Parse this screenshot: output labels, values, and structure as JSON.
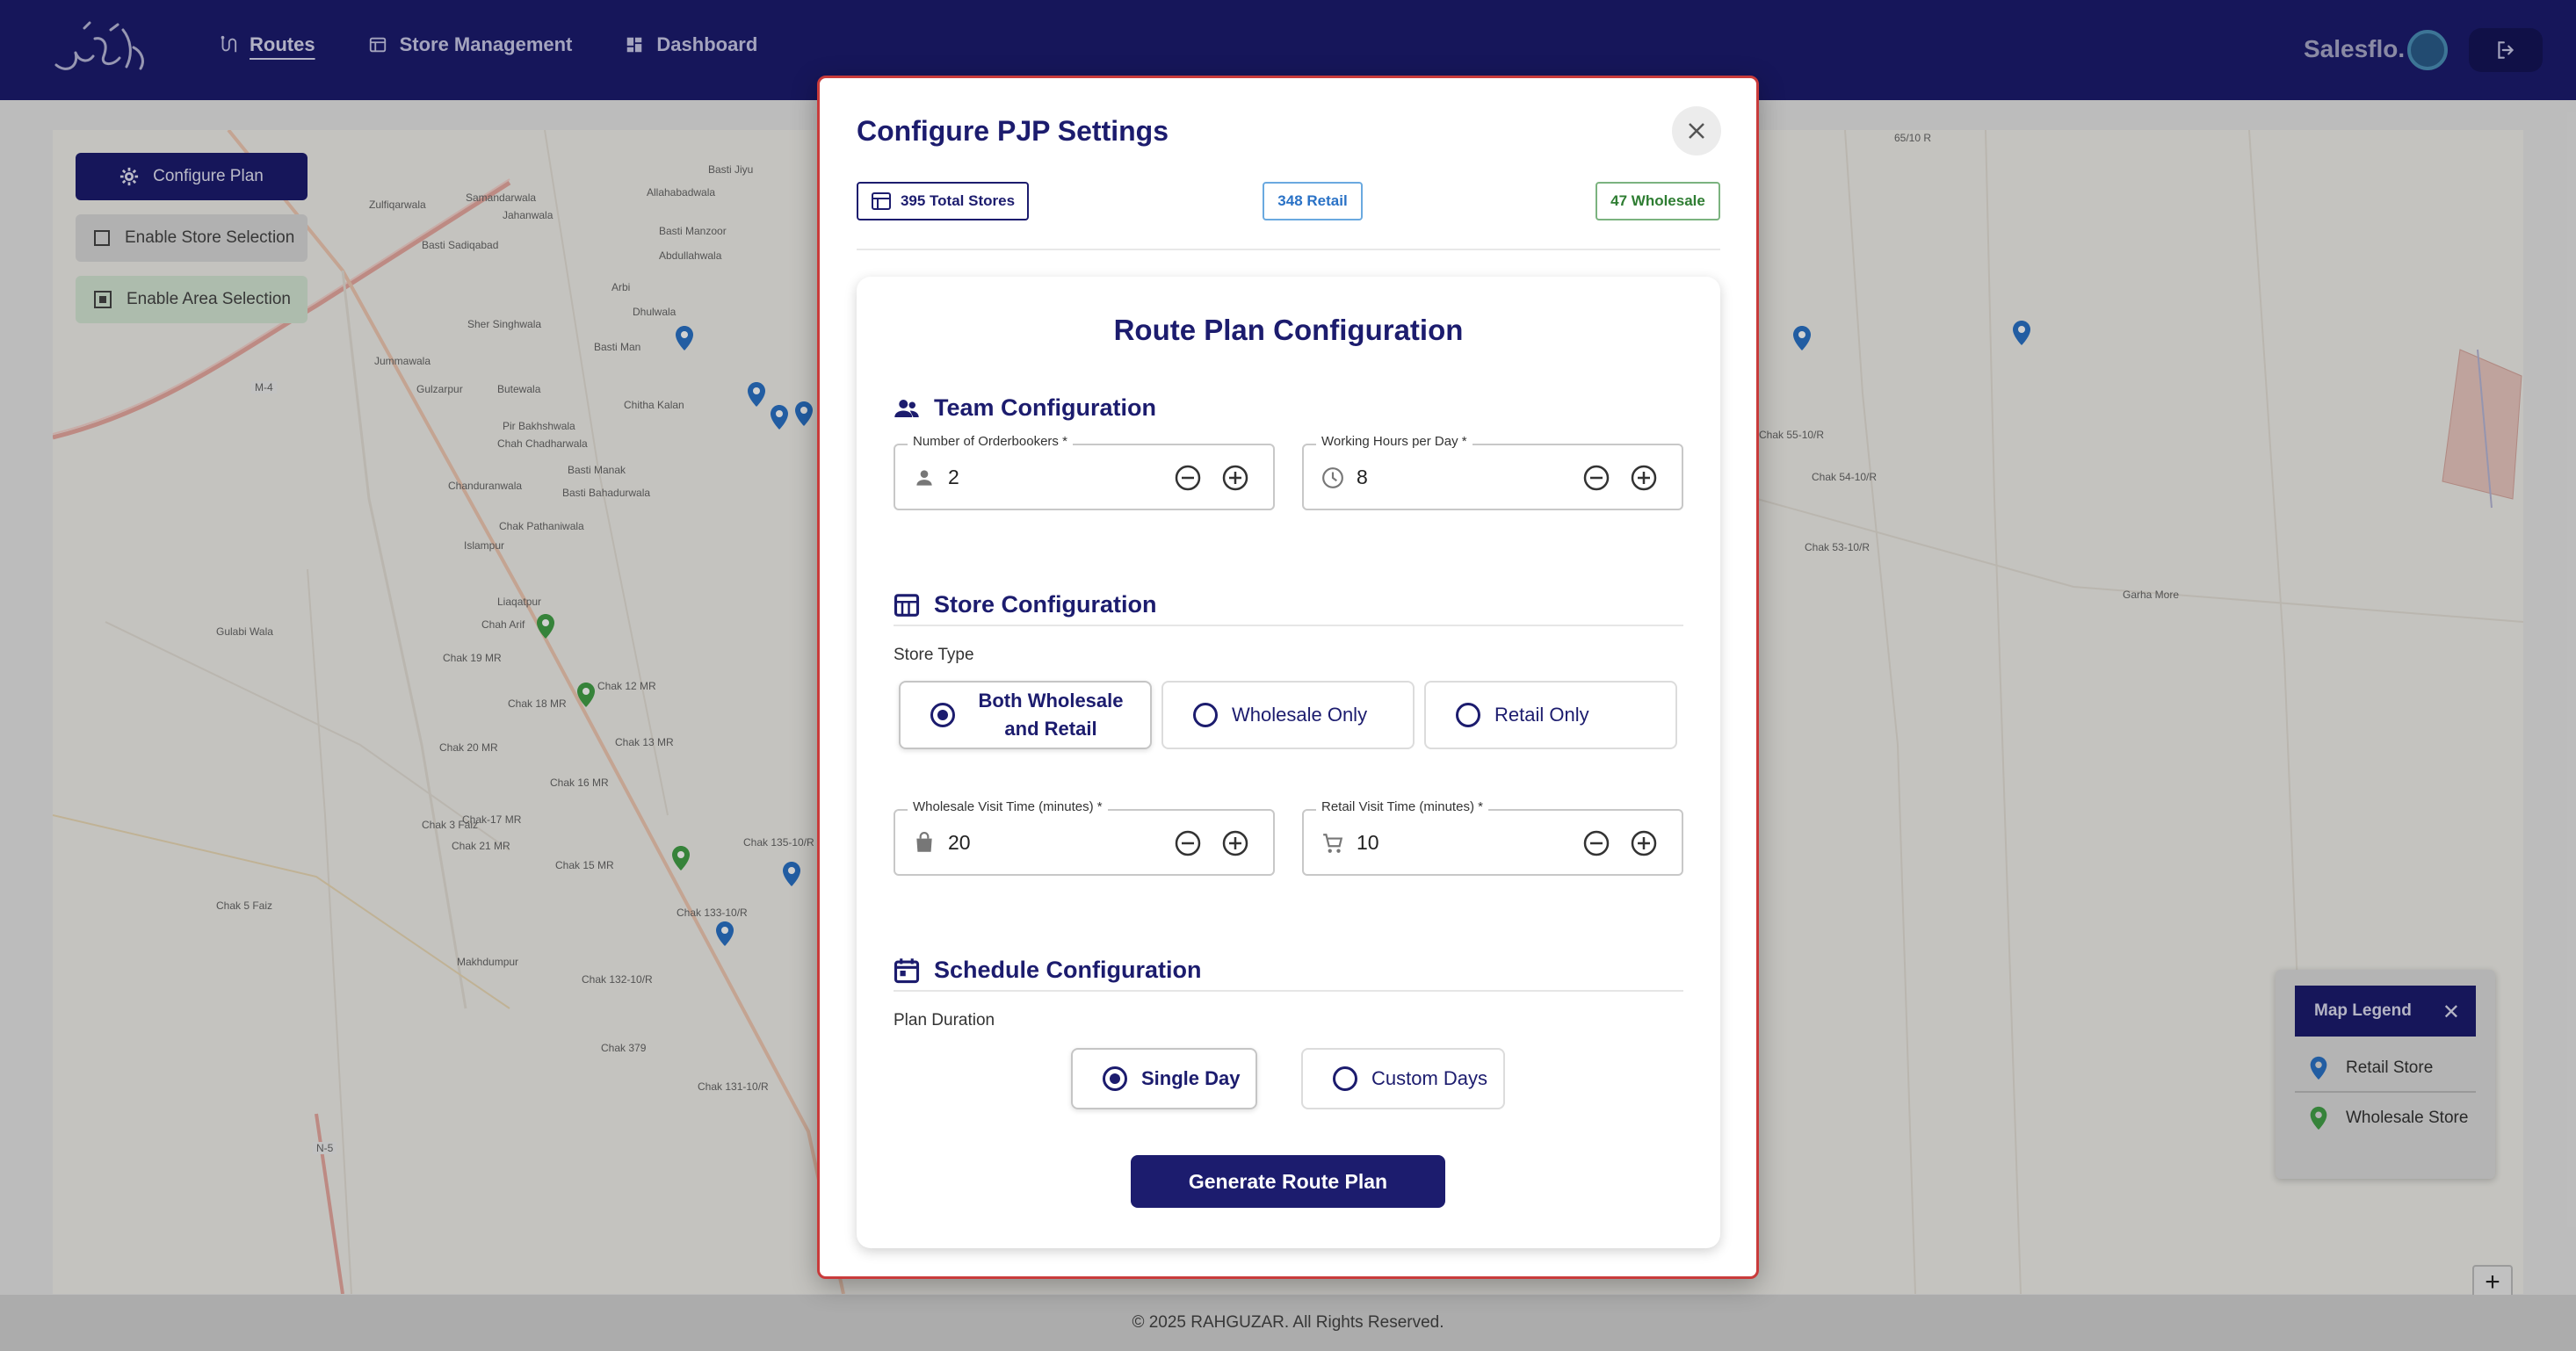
{
  "nav": {
    "logo_text": "ره گزر",
    "links": [
      {
        "label": "Routes",
        "icon": "route-icon",
        "active": true
      },
      {
        "label": "Store Management",
        "icon": "store-icon",
        "active": false
      },
      {
        "label": "Dashboard",
        "icon": "dashboard-icon",
        "active": false
      }
    ],
    "brand": "Salesflo.",
    "logout_icon": "logout-icon"
  },
  "map": {
    "controls": {
      "configure_plan": "Configure Plan",
      "enable_store_selection": "Enable Store Selection",
      "enable_area_selection": "Enable Area Selection"
    },
    "places": [
      "Basti Jiyu",
      "Allahabadwala",
      "Samandarwala",
      "Zulfiqarwala",
      "Jahanwala",
      "Basti Sadiqabad",
      "Basti Manzoor",
      "Abdullahwala",
      "Arbi",
      "Dhulwala",
      "Sher Singhwala",
      "Basti Man",
      "Jummawala",
      "Gulzarpur",
      "Butewala",
      "Chitha Kalan",
      "Pir Bakhshwala",
      "Chah Chadharwala",
      "Basti Manak",
      "Chanduranwala",
      "Basti Bahadurwala",
      "Chak Pathaniwala",
      "Islampur",
      "Liaqatpur",
      "Chah Arif",
      "Chak 19 MR",
      "Gulabi Wala",
      "Chak 18 MR",
      "Chak 12 MR",
      "Chak 20 MR",
      "Chak 13 MR",
      "Chak 16 MR",
      "Chak 3 Faiz",
      "Chak-17 MR",
      "Chak 21 MR",
      "Chak 15 MR",
      "Chak 135-10/R",
      "Chak 5 Faiz",
      "Chak 133-10/R",
      "Makhdumpur",
      "Chak 132-10/R",
      "Chak 379",
      "Chak 131-10/R",
      "M-4",
      "N-5",
      "65/10 R",
      "Chak 55-10/R",
      "Chak 54-10/R",
      "Chak 53-10/R",
      "Garha More"
    ],
    "legend": {
      "title": "Map Legend",
      "items": [
        {
          "label": "Retail Store",
          "color": "#2a72c6"
        },
        {
          "label": "Wholesale Store",
          "color": "#43a047"
        }
      ]
    },
    "zoom_in": "+"
  },
  "modal": {
    "title": "Configure PJP Settings",
    "stats": {
      "total": "395 Total Stores",
      "retail": "348 Retail",
      "wholesale": "47 Wholesale"
    },
    "card_title": "Route Plan Configuration",
    "team": {
      "heading": "Team Configuration",
      "orderbookers_label": "Number of Orderbookers *",
      "orderbookers_value": "2",
      "hours_label": "Working Hours per Day *",
      "hours_value": "8"
    },
    "store": {
      "heading": "Store Configuration",
      "type_label": "Store Type",
      "options": [
        "Both Wholesale",
        "and Retail",
        "Wholesale Only",
        "Retail Only"
      ],
      "selected": "Both Wholesale and Retail",
      "wholesale_time_label": "Wholesale Visit Time (minutes) *",
      "wholesale_time_value": "20",
      "retail_time_label": "Retail Visit Time (minutes) *",
      "retail_time_value": "10"
    },
    "schedule": {
      "heading": "Schedule Configuration",
      "duration_label": "Plan Duration",
      "options": [
        "Single Day",
        "Custom Days"
      ],
      "selected": "Single Day"
    },
    "generate_label": "Generate Route Plan"
  },
  "footer": {
    "text": "© 2025 RAHGUZAR. All Rights Reserved."
  },
  "colors": {
    "primary": "#1c1c6e",
    "retail": "#2a72c6",
    "wholesale": "#43a047",
    "modal_border": "#c93b3b"
  }
}
